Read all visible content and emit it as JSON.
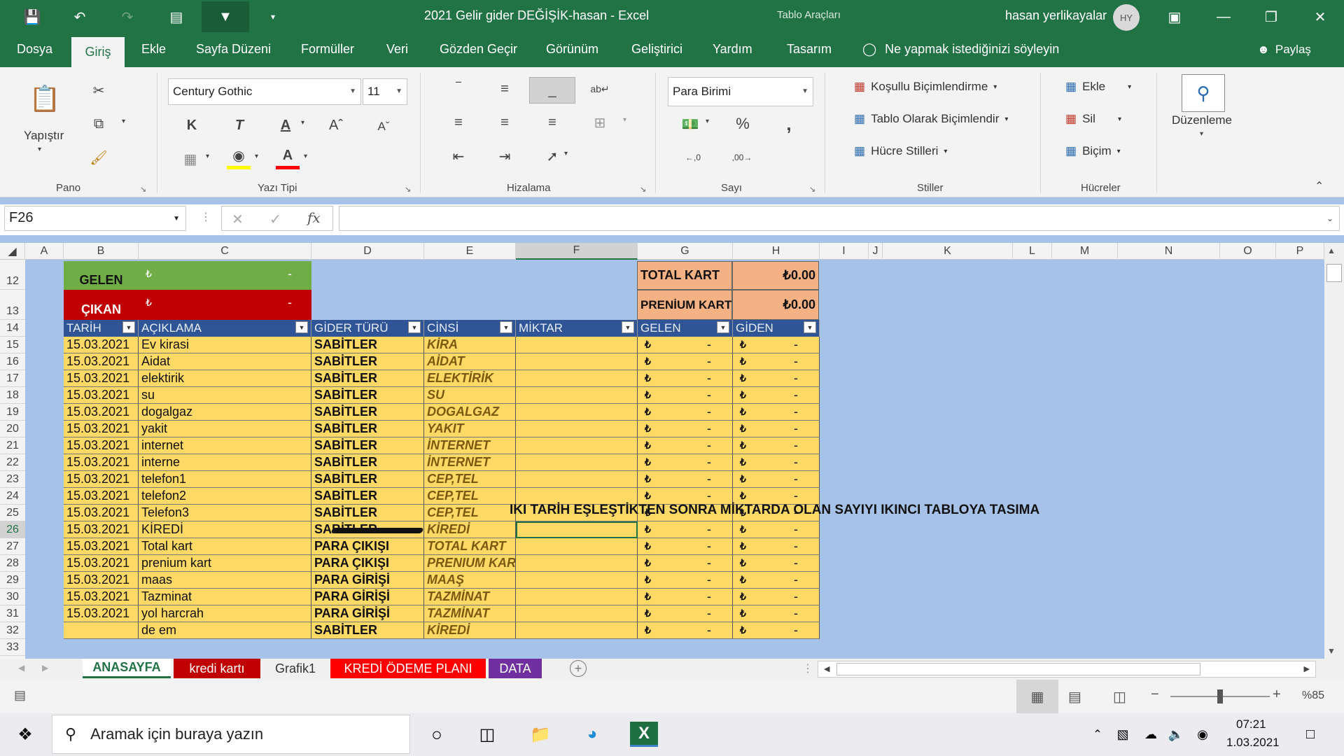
{
  "window": {
    "title": "2021 Gelir gider DEĞİŞİK-hasan  -  Excel",
    "context_tools": "Tablo Araçları",
    "user_name": "hasan yerlikayalar",
    "user_initials": "HY"
  },
  "menu": {
    "tabs": [
      "Dosya",
      "Giriş",
      "Ekle",
      "Sayfa Düzeni",
      "Formüller",
      "Veri",
      "Gözden Geçir",
      "Görünüm",
      "Geliştirici",
      "Yardım",
      "Tasarım"
    ],
    "active_tab": "Giriş",
    "tell_me": "Ne yapmak istediğinizi söyleyin",
    "share": "Paylaş"
  },
  "ribbon": {
    "paste_label": "Yapıştır",
    "groups": [
      "Pano",
      "Yazı Tipi",
      "Hizalama",
      "Sayı",
      "Stiller",
      "Hücreler"
    ],
    "font_name": "Century Gothic",
    "font_size": "11",
    "number_format": "Para Birimi",
    "conditional_format": "Koşullu Biçimlendirme",
    "format_as_table": "Tablo Olarak Biçimlendir",
    "cell_styles": "Hücre Stilleri",
    "insert": "Ekle",
    "delete": "Sil",
    "format": "Biçim",
    "editing": "Düzenleme"
  },
  "formula_bar": {
    "name_box": "F26",
    "formula": ""
  },
  "grid": {
    "columns": [
      "A",
      "B",
      "C",
      "D",
      "E",
      "F",
      "G",
      "H",
      "I",
      "J",
      "K",
      "L",
      "M",
      "N",
      "O",
      "P"
    ],
    "row_numbers": [
      "12",
      "13",
      "14",
      "15",
      "16",
      "17",
      "18",
      "19",
      "20",
      "21",
      "22",
      "23",
      "24",
      "25",
      "26",
      "27",
      "28",
      "29",
      "30",
      "31",
      "32",
      "33"
    ],
    "summary": {
      "gelen_label": "GELEN",
      "cikan_label": "ÇIKAN",
      "currency_symbol": "₺",
      "dash": "-",
      "total_kart_label": "TOTAL KART",
      "total_kart_value": "₺0.00",
      "prenium_kart_label": "PRENİUM KART",
      "prenium_kart_value": "₺0.00"
    },
    "table_headers": [
      "TARİH",
      "AÇIKLAMA",
      "GİDER TÜRÜ",
      "CİNSİ",
      "MİKTAR",
      "GELEN",
      "GİDEN"
    ],
    "rows": [
      [
        "15.03.2021",
        "Ev kirasi",
        "SABİTLER",
        "KİRA"
      ],
      [
        "15.03.2021",
        "Aidat",
        "SABİTLER",
        "AİDAT"
      ],
      [
        "15.03.2021",
        "elektirik",
        "SABİTLER",
        "ELEKTİRİK"
      ],
      [
        "15.03.2021",
        "su",
        "SABİTLER",
        "SU"
      ],
      [
        "15.03.2021",
        "dogalgaz",
        "SABİTLER",
        "DOGALGAZ"
      ],
      [
        "15.03.2021",
        "yakit",
        "SABİTLER",
        "YAKIT"
      ],
      [
        "15.03.2021",
        "internet",
        "SABİTLER",
        "İNTERNET"
      ],
      [
        "15.03.2021",
        "interne",
        "SABİTLER",
        "İNTERNET"
      ],
      [
        "15.03.2021",
        "telefon1",
        "SABİTLER",
        "CEP,TEL"
      ],
      [
        "15.03.2021",
        "telefon2",
        "SABİTLER",
        "CEP,TEL"
      ],
      [
        "15.03.2021",
        "Telefon3",
        "SABİTLER",
        "CEP,TEL"
      ],
      [
        "15.03.2021",
        "KİREDİ",
        "SABİTLER",
        "KİREDİ"
      ],
      [
        "15.03.2021",
        "Total kart",
        "PARA ÇIKIŞI",
        "TOTAL KART"
      ],
      [
        "15.03.2021",
        "prenium kart",
        "PARA ÇIKIŞI",
        "PRENIUM KART"
      ],
      [
        "15.03.2021",
        "maas",
        "PARA GİRİŞİ",
        "MAAŞ"
      ],
      [
        "15.03.2021",
        "Tazminat",
        "PARA GİRİŞİ",
        "TAZMİNAT"
      ],
      [
        "15.03.2021",
        "yol harcrah",
        "PARA GİRİŞİ",
        "TAZMİNAT"
      ],
      [
        "",
        "de em",
        "SABİTLER",
        "KİREDİ"
      ]
    ],
    "annotation": "IKI TARİH EŞLEŞTİKTEN SONRA MİKTARDA OLAN SAYIYI IKINCI TABLOYA TASIMA"
  },
  "sheet_tabs": [
    {
      "name": "ANASAYFA",
      "bg": "#ffffff",
      "fg": "#217346"
    },
    {
      "name": "kredi kartı",
      "bg": "#c00000",
      "fg": "#ffffff"
    },
    {
      "name": "Grafik1",
      "bg": "#f0f0f0",
      "fg": "#333333"
    },
    {
      "name": "KREDİ ÖDEME PLANI",
      "bg": "#ff0000",
      "fg": "#ffffff"
    },
    {
      "name": "DATA",
      "bg": "#7030a0",
      "fg": "#ffffff"
    }
  ],
  "status_bar": {
    "zoom": "%85"
  },
  "taskbar": {
    "search_placeholder": "Aramak için buraya yazın",
    "time": "07:21",
    "date": "1.03.2021"
  },
  "colors": {
    "excel_green": "#217346",
    "gelen_green": "#70ad47",
    "cikan_red": "#c00000",
    "card_orange": "#f4b183",
    "table_header_blue": "#2f5597",
    "row_yellow": "#ffd966",
    "sheet_blue": "#a7c2e8"
  }
}
